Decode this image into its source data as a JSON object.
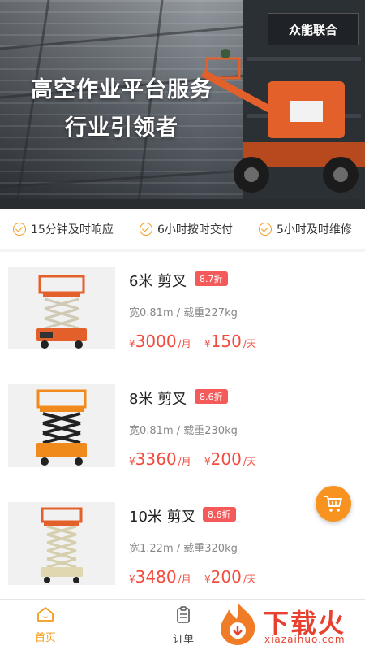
{
  "banner": {
    "headline_line1": "高空作业平台服务",
    "headline_line2": "行业引领者",
    "brand_sign": "众能联合",
    "image": "aerial-work-platform-photo"
  },
  "promises": [
    {
      "icon": "check-circle-icon",
      "text": "15分钟及时响应"
    },
    {
      "icon": "check-circle-icon",
      "text": "6小时按时交付"
    },
    {
      "icon": "check-circle-icon",
      "text": "5小时及时维修"
    }
  ],
  "products": [
    {
      "name": "6米 剪叉",
      "discount": "8.7折",
      "spec": "宽0.81m / 载重227kg",
      "currency": "¥",
      "monthly_price": "3000",
      "monthly_unit": "/月",
      "daily_price": "150",
      "daily_unit": "/天",
      "image": "orange-scissor-lift-6m"
    },
    {
      "name": "8米 剪叉",
      "discount": "8.6折",
      "spec": "宽0.81m / 载重230kg",
      "currency": "¥",
      "monthly_price": "3360",
      "monthly_unit": "/月",
      "daily_price": "200",
      "daily_unit": "/天",
      "image": "orange-scissor-lift-8m"
    },
    {
      "name": "10米 剪叉",
      "discount": "8.6折",
      "spec": "宽1.22m / 载重320kg",
      "currency": "¥",
      "monthly_price": "3480",
      "monthly_unit": "/月",
      "daily_price": "200",
      "daily_unit": "/天",
      "image": "orange-scissor-lift-10m"
    }
  ],
  "cart_fab": {
    "icon": "shopping-cart-icon"
  },
  "tabbar": {
    "home": {
      "label": "首页",
      "icon": "home-icon"
    },
    "orders": {
      "label": "订单",
      "icon": "clipboard-icon"
    }
  },
  "watermark": {
    "text": "下载火",
    "url_text": "xiazaihuo.com"
  },
  "colors": {
    "accent": "#f39a1e",
    "price": "#f24b3d",
    "discount_bg": "#f55a5a"
  }
}
